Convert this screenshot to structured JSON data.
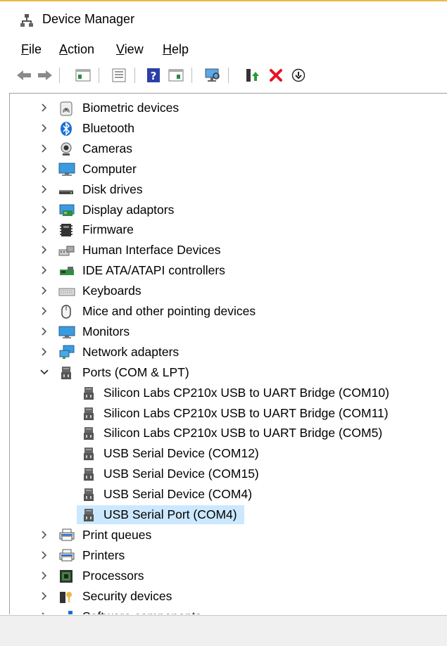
{
  "window": {
    "title": "Device Manager"
  },
  "menu": [
    {
      "key": "F",
      "rest": "ile"
    },
    {
      "key": "A",
      "rest": "ction"
    },
    {
      "key": "V",
      "rest": "iew"
    },
    {
      "key": "H",
      "rest": "elp"
    }
  ],
  "toolbar": [
    "back-icon",
    "forward-icon",
    "properties-pane-icon",
    "properties-icon",
    "help-icon",
    "show-hidden-icon",
    "scan-hardware-icon",
    "update-driver-icon",
    "uninstall-icon",
    "download-icon"
  ],
  "tree": [
    {
      "label": "Biometric devices",
      "icon": "fingerprint-icon",
      "expanded": false
    },
    {
      "label": "Bluetooth",
      "icon": "bluetooth-icon",
      "expanded": false
    },
    {
      "label": "Cameras",
      "icon": "camera-icon",
      "expanded": false
    },
    {
      "label": "Computer",
      "icon": "computer-icon",
      "expanded": false
    },
    {
      "label": "Disk drives",
      "icon": "disk-drive-icon",
      "expanded": false
    },
    {
      "label": "Display adaptors",
      "icon": "display-adapter-icon",
      "expanded": false
    },
    {
      "label": "Firmware",
      "icon": "firmware-icon",
      "expanded": false
    },
    {
      "label": "Human Interface Devices",
      "icon": "hid-icon",
      "expanded": false
    },
    {
      "label": "IDE ATA/ATAPI controllers",
      "icon": "ide-controller-icon",
      "expanded": false
    },
    {
      "label": "Keyboards",
      "icon": "keyboard-icon",
      "expanded": false
    },
    {
      "label": "Mice and other pointing devices",
      "icon": "mouse-icon",
      "expanded": false
    },
    {
      "label": "Monitors",
      "icon": "monitor-icon",
      "expanded": false
    },
    {
      "label": "Network adapters",
      "icon": "network-adapter-icon",
      "expanded": false
    },
    {
      "label": "Ports (COM & LPT)",
      "icon": "port-icon",
      "expanded": true,
      "children": [
        {
          "label": "Silicon Labs CP210x USB to UART Bridge (COM10)"
        },
        {
          "label": "Silicon Labs CP210x USB to UART Bridge (COM11)"
        },
        {
          "label": "Silicon Labs CP210x USB to UART Bridge (COM5)"
        },
        {
          "label": "USB Serial Device (COM12)"
        },
        {
          "label": "USB Serial Device (COM15)"
        },
        {
          "label": "USB Serial Device (COM4)"
        },
        {
          "label": "USB Serial Port (COM4)",
          "selected": true
        }
      ]
    },
    {
      "label": "Print queues",
      "icon": "printer-icon",
      "expanded": false
    },
    {
      "label": "Printers",
      "icon": "printer-icon",
      "expanded": false
    },
    {
      "label": "Processors",
      "icon": "processor-icon",
      "expanded": false
    },
    {
      "label": "Security devices",
      "icon": "security-device-icon",
      "expanded": false
    },
    {
      "label": "Software components",
      "icon": "software-component-icon",
      "expanded": false
    }
  ],
  "status": {
    "text": ""
  },
  "colors": {
    "selection": "#cce8ff",
    "accent_red": "#e81123",
    "accent_blue": "#1a6fd4"
  }
}
